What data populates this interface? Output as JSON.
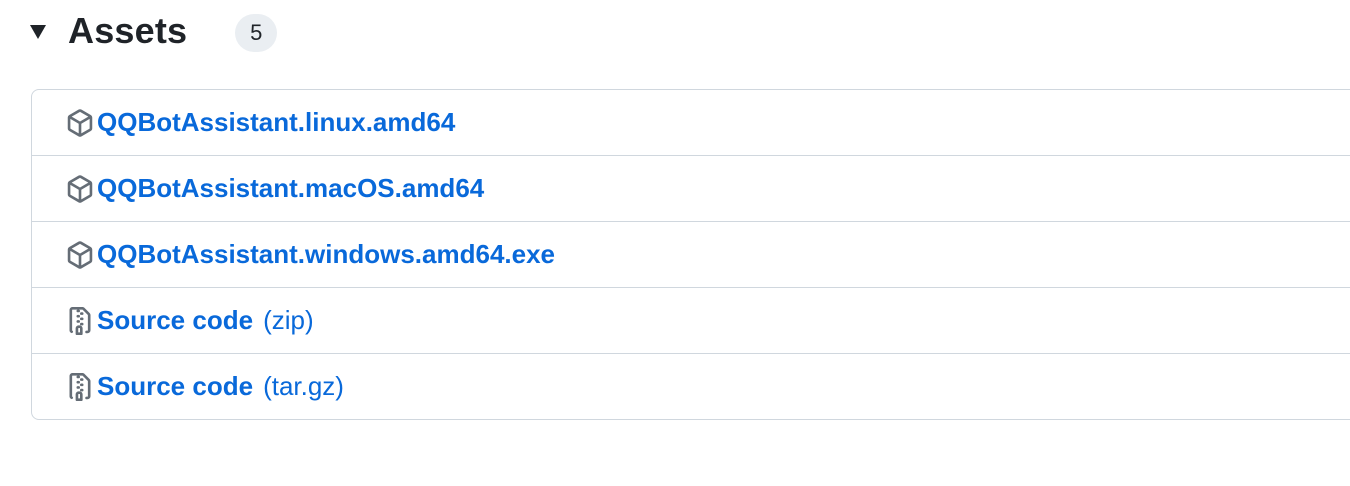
{
  "assets": {
    "title": "Assets",
    "count": "5",
    "items": [
      {
        "name": "QQBotAssistant.linux.amd64",
        "suffix": "",
        "icon": "package-icon"
      },
      {
        "name": "QQBotAssistant.macOS.amd64",
        "suffix": "",
        "icon": "package-icon"
      },
      {
        "name": "QQBotAssistant.windows.amd64.exe",
        "suffix": "",
        "icon": "package-icon"
      },
      {
        "name": "Source code",
        "suffix": "(zip)",
        "icon": "file-zip-icon"
      },
      {
        "name": "Source code",
        "suffix": "(tar.gz)",
        "icon": "file-zip-icon"
      }
    ]
  },
  "colors": {
    "link": "#0969da",
    "border": "#d0d7de",
    "counter_bg": "#eaeef2",
    "icon": "#656d76"
  }
}
